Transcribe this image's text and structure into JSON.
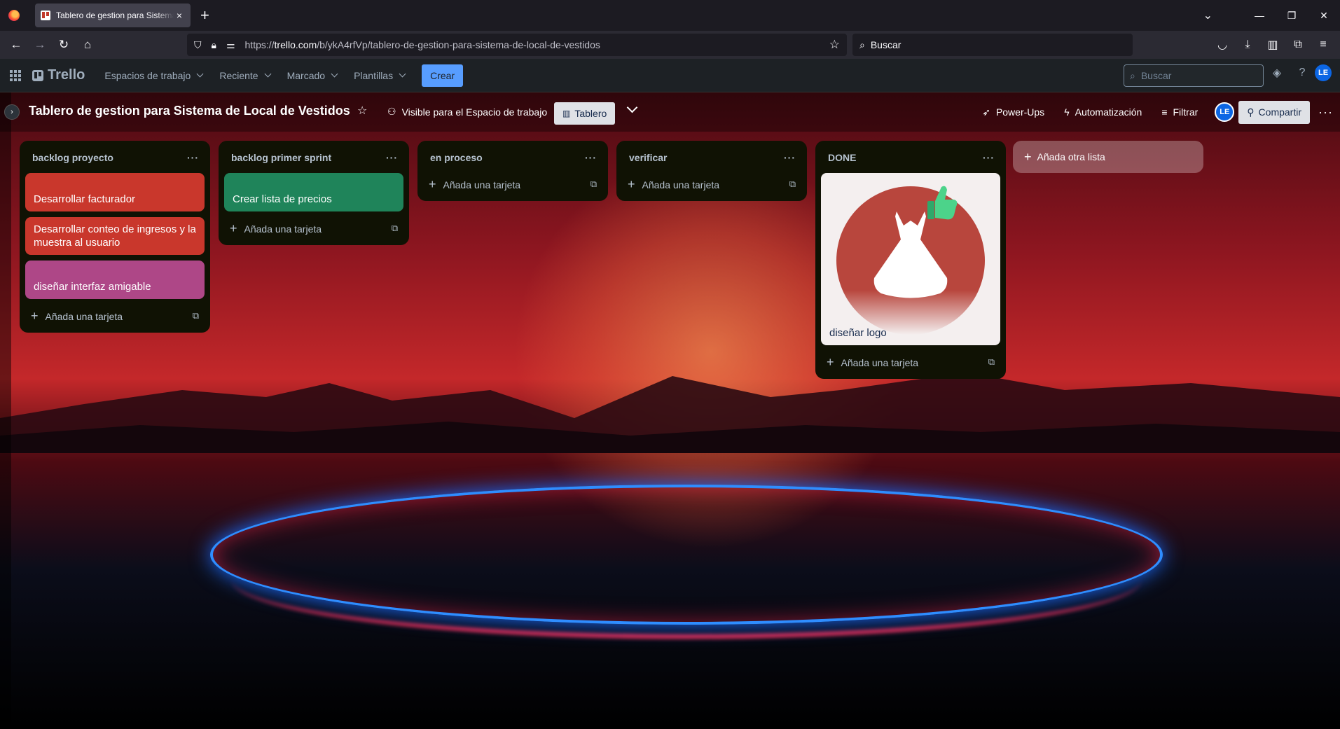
{
  "browser": {
    "tab_title": "Tablero de gestion para Sistema",
    "tab_close": "×",
    "new_tab": "+",
    "url_prefix": "https://",
    "url_host": "trello.com",
    "url_path": "/b/ykA4rfVp/tablero-de-gestion-para-sistema-de-local-de-vestidos",
    "search_placeholder": "Buscar"
  },
  "header": {
    "logo": "Trello",
    "menu": [
      {
        "label": "Espacios de trabajo"
      },
      {
        "label": "Reciente"
      },
      {
        "label": "Marcado"
      },
      {
        "label": "Plantillas"
      }
    ],
    "create_label": "Crear",
    "search_placeholder": "Buscar",
    "avatar": "LE"
  },
  "board": {
    "title": "Tablero de gestion para Sistema de Local de Vestidos",
    "visibility": "Visible para el Espacio de trabajo",
    "view": "Tablero",
    "powerups": "Power-Ups",
    "automation": "Automatización",
    "filter": "Filtrar",
    "avatar": "LE",
    "share": "Compartir",
    "add_list": "Añada otra lista"
  },
  "lists": [
    {
      "title": "backlog proyecto",
      "cards": [
        {
          "text": "Desarrollar facturador",
          "color": "#c9372c"
        },
        {
          "text": "Desarrollar conteo de ingresos y la muestra al usuario",
          "color": "#c9372c"
        },
        {
          "text": "diseñar interfaz amigable",
          "color": "#ae4787"
        }
      ],
      "add_card": "Añada una tarjeta"
    },
    {
      "title": "backlog primer sprint",
      "cards": [
        {
          "text": "Crear lista de precios",
          "color": "#1f845a"
        }
      ],
      "add_card": "Añada una tarjeta"
    },
    {
      "title": "en proceso",
      "cards": [],
      "add_card": "Añada una tarjeta"
    },
    {
      "title": "verificar",
      "cards": [],
      "add_card": "Añada una tarjeta"
    },
    {
      "title": "DONE",
      "cards": [
        {
          "text": "diseñar logo",
          "image": "dress-logo"
        }
      ],
      "add_card": "Añada una tarjeta"
    }
  ],
  "icons": {
    "more": "···",
    "plus": "+"
  }
}
